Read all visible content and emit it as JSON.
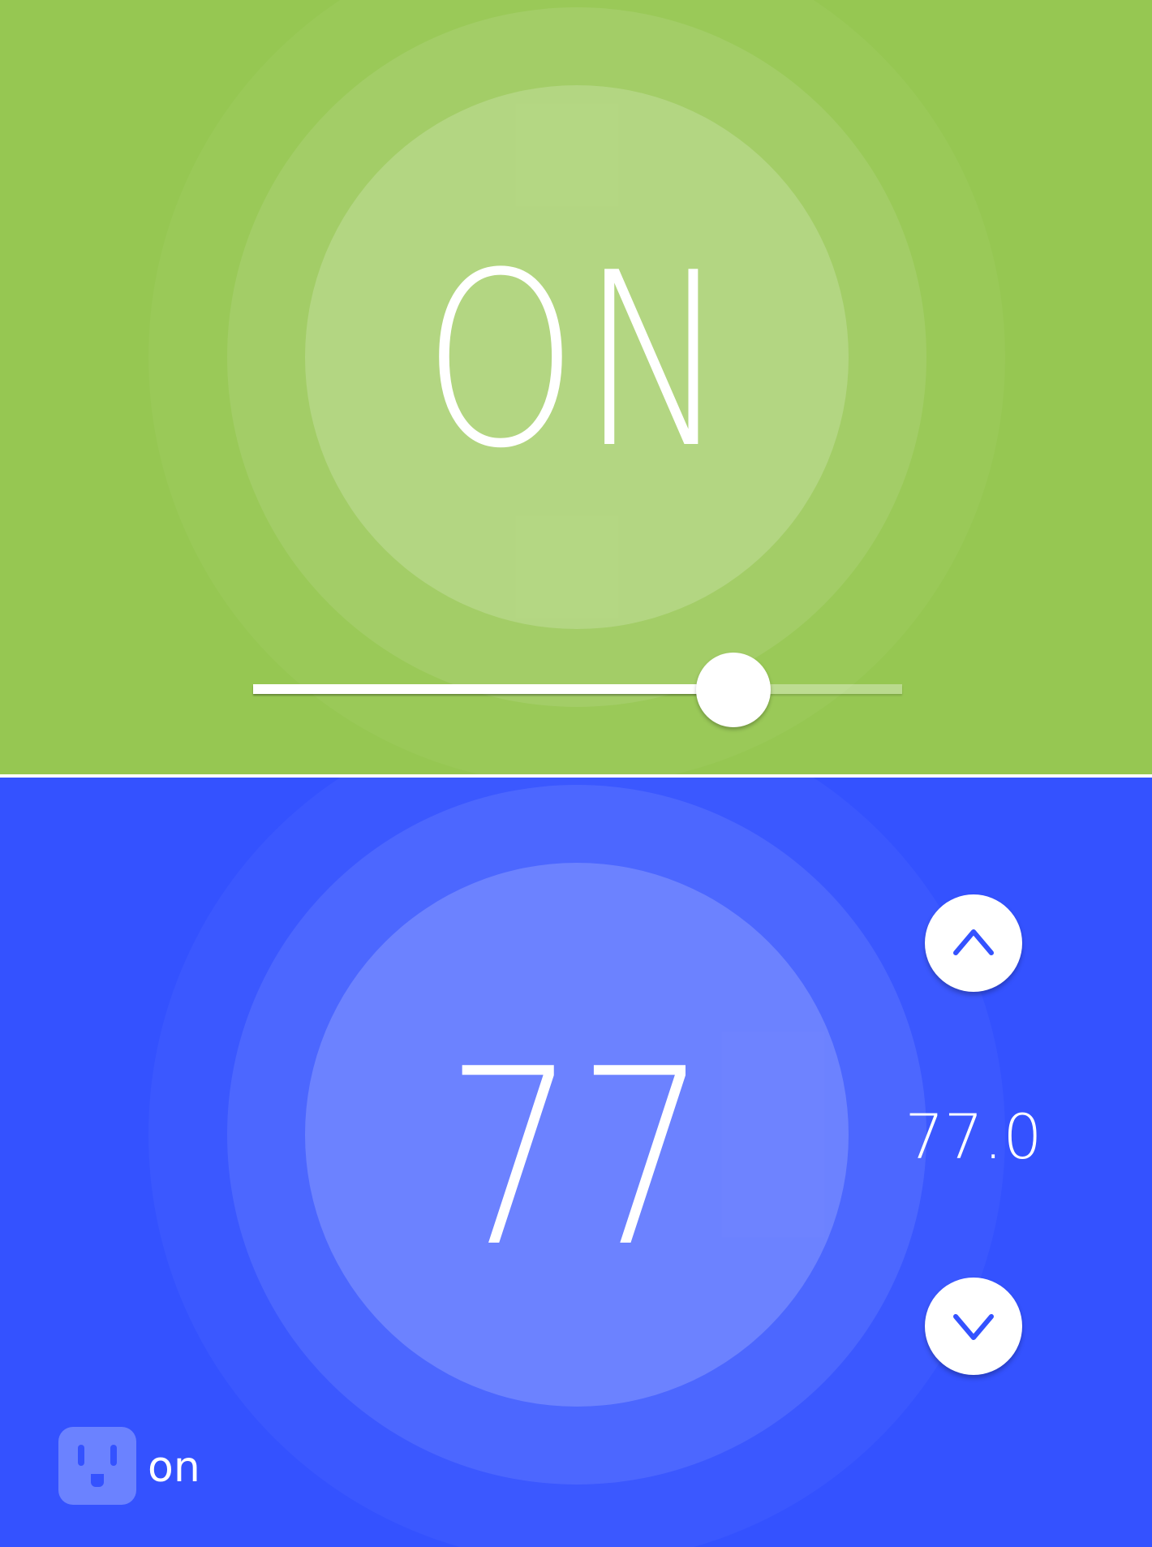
{
  "power_panel": {
    "label": "ON",
    "background_color": "#96c752",
    "slider": {
      "level_fraction": 0.74
    }
  },
  "thermostat_panel": {
    "background_color": "#3452ff",
    "setpoint": "77",
    "current_temperature": "77.0",
    "up_button": {
      "icon": "chevron-up-icon"
    },
    "down_button": {
      "icon": "chevron-down-icon"
    },
    "device": {
      "icon": "power-outlet-icon",
      "status": "on"
    }
  }
}
